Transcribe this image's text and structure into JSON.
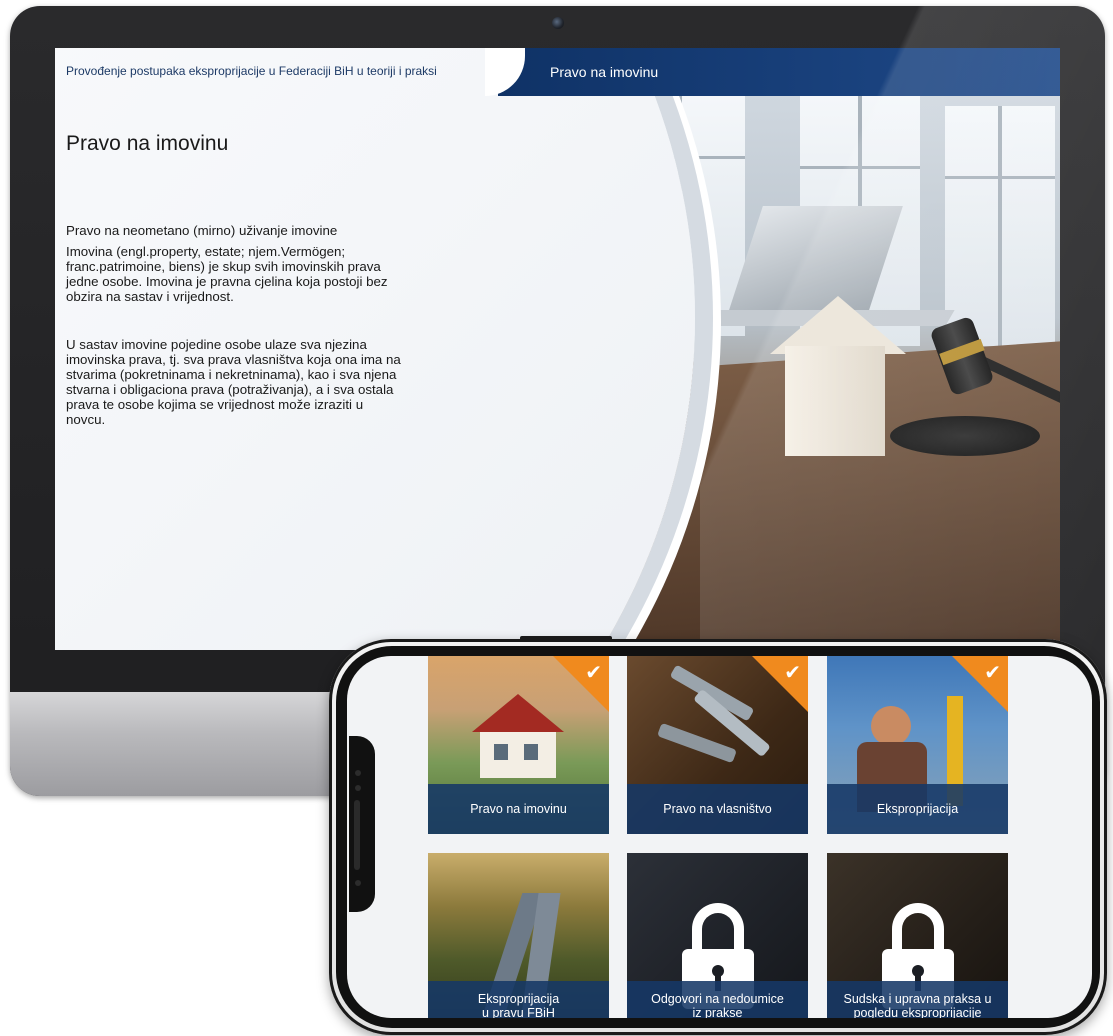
{
  "desktop": {
    "course_title": "Provođenje postupaka eksproprijacije u Federaciji BiH u teoriji i praksi",
    "module_title": "Pravo na imovinu",
    "page_heading": "Pravo na imovinu",
    "subheading": "Pravo na neometano (mirno) uživanje imovine",
    "paragraph_1": "Imovina (engl.property, estate; njem.Vermögen; franc.patrimoine, biens) je skup svih imovinskih prava jedne osobe. Imovina je pravna cjelina koja postoji bez obzira na sastav i vrijednost.",
    "paragraph_2": "U sastav imovine pojedine osobe ulaze sva njezina imovinska prava, tj. sva prava vlasništva koja ona ima na stvarima (pokretninama i nekretninama), kao i sva njena stvarna i obligaciona prava (potraživanja), a i sva ostala prava te osobe kojima se vrijednost može izraziti u novcu."
  },
  "phone": {
    "tiles": [
      {
        "label": "Pravo na imovinu",
        "completed": true,
        "locked": false,
        "check": "✔"
      },
      {
        "label": "Pravo na vlasništvo",
        "completed": true,
        "locked": false,
        "check": "✔"
      },
      {
        "label": "Eksproprijacija",
        "completed": true,
        "locked": false,
        "check": "✔"
      },
      {
        "label": "Eksproprijacija\nu pravu FBiH",
        "completed": false,
        "locked": false
      },
      {
        "label": "Odgovori na nedoumice\niz prakse",
        "completed": false,
        "locked": true
      },
      {
        "label": "Sudska i upravna praksa u\npogledu eksproprijacije",
        "completed": false,
        "locked": true
      }
    ]
  },
  "colors": {
    "title_bar": "#1f4a8a",
    "tile_label_bg": "#163866",
    "completed_badge": "#f08a1e"
  }
}
